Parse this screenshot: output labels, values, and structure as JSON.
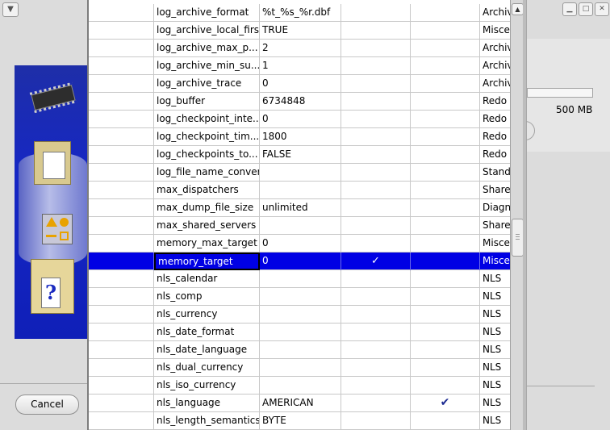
{
  "background_window": {
    "cancel_label": "Cancel",
    "storage_size": "500 MB"
  },
  "table": {
    "rows": [
      {
        "name": "log_archive_format",
        "value": "%t_%s_%r.dbf",
        "default": "",
        "dynamic": "",
        "category": "Archive"
      },
      {
        "name": "log_archive_local_first",
        "value": "TRUE",
        "default": "",
        "dynamic": "",
        "category": "Miscellaneous"
      },
      {
        "name": "log_archive_max_p...",
        "value": "2",
        "default": "",
        "dynamic": "",
        "category": "Archive"
      },
      {
        "name": "log_archive_min_su...",
        "value": "1",
        "default": "",
        "dynamic": "",
        "category": "Archive"
      },
      {
        "name": "log_archive_trace",
        "value": "0",
        "default": "",
        "dynamic": "",
        "category": "Archive"
      },
      {
        "name": "log_buffer",
        "value": "6734848",
        "default": "",
        "dynamic": "",
        "category": "Redo"
      },
      {
        "name": "log_checkpoint_inte...",
        "value": "0",
        "default": "",
        "dynamic": "",
        "category": "Redo"
      },
      {
        "name": "log_checkpoint_tim...",
        "value": "1800",
        "default": "",
        "dynamic": "",
        "category": "Redo"
      },
      {
        "name": "log_checkpoints_to...",
        "value": "FALSE",
        "default": "",
        "dynamic": "",
        "category": "Redo"
      },
      {
        "name": "log_file_name_convert",
        "value": "",
        "default": "",
        "dynamic": "",
        "category": "Standby"
      },
      {
        "name": "max_dispatchers",
        "value": "",
        "default": "",
        "dynamic": "",
        "category": "Shared"
      },
      {
        "name": "max_dump_file_size",
        "value": "unlimited",
        "default": "",
        "dynamic": "",
        "category": "Diagnostics"
      },
      {
        "name": "max_shared_servers",
        "value": "",
        "default": "",
        "dynamic": "",
        "category": "Shared"
      },
      {
        "name": "memory_max_target",
        "value": "0",
        "default": "",
        "dynamic": "",
        "category": "Miscellaneous"
      },
      {
        "name": "memory_target",
        "value": "0",
        "default": "✓",
        "dynamic": "",
        "category": "Miscellaneous",
        "selected": true
      },
      {
        "name": "nls_calendar",
        "value": "",
        "default": "",
        "dynamic": "",
        "category": "NLS"
      },
      {
        "name": "nls_comp",
        "value": "",
        "default": "",
        "dynamic": "",
        "category": "NLS"
      },
      {
        "name": "nls_currency",
        "value": "",
        "default": "",
        "dynamic": "",
        "category": "NLS"
      },
      {
        "name": "nls_date_format",
        "value": "",
        "default": "",
        "dynamic": "",
        "category": "NLS"
      },
      {
        "name": "nls_date_language",
        "value": "",
        "default": "",
        "dynamic": "",
        "category": "NLS"
      },
      {
        "name": "nls_dual_currency",
        "value": "",
        "default": "",
        "dynamic": "",
        "category": "NLS"
      },
      {
        "name": "nls_iso_currency",
        "value": "",
        "default": "",
        "dynamic": "",
        "category": "NLS"
      },
      {
        "name": "nls_language",
        "value": "AMERICAN",
        "default": "",
        "dynamic": "✔",
        "category": "NLS"
      },
      {
        "name": "nls_length_semantics",
        "value": "BYTE",
        "default": "",
        "dynamic": "",
        "category": "NLS"
      }
    ]
  },
  "icons": {
    "window_menu": "chevron-down-icon",
    "minimize": "minimize-icon",
    "maximize": "maximize-icon",
    "close": "close-icon",
    "scroll_up": "arrow-up-icon"
  },
  "colors": {
    "selection": "#0000e4",
    "check_blue": "#1d2c92",
    "wizard_blue": "#1627c4"
  }
}
